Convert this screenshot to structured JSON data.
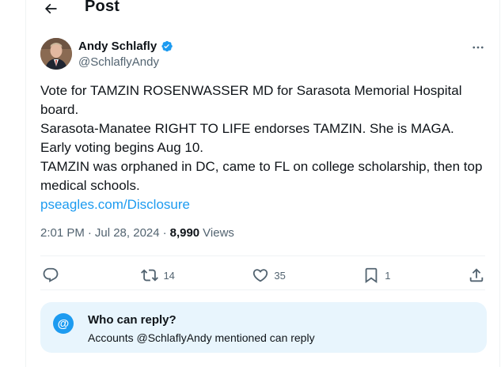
{
  "header": {
    "title": "Post",
    "back_icon": "arrow-left-icon"
  },
  "author": {
    "display_name": "Andy Schlafly",
    "handle": "@SchlaflyAndy",
    "verified_color": "#1d9bf0"
  },
  "tweet": {
    "lines": [
      "Vote for TAMZIN ROSENWASSER MD for Sarasota Memorial Hospital board.",
      "Sarasota-Manatee RIGHT TO LIFE endorses TAMZIN. She is MAGA.",
      "Early voting begins Aug 10.",
      "TAMZIN was orphaned in DC, came to FL on college scholarship, then top medical schools."
    ],
    "link": "pseagles.com/Disclosure"
  },
  "meta": {
    "time": "2:01 PM",
    "date": "Jul 28, 2024",
    "views_count": "8,990",
    "views_label": "Views"
  },
  "actions": {
    "reply_count": "",
    "repost_count": "14",
    "like_count": "35",
    "bookmark_count": "1"
  },
  "reply_restriction": {
    "title": "Who can reply?",
    "description": "Accounts @SchlaflyAndy mentioned can reply",
    "icon": "@"
  },
  "colors": {
    "accent": "#1d9bf0",
    "text": "#0f1419",
    "muted": "#536471",
    "reply_box_bg": "#e8f5fd"
  }
}
